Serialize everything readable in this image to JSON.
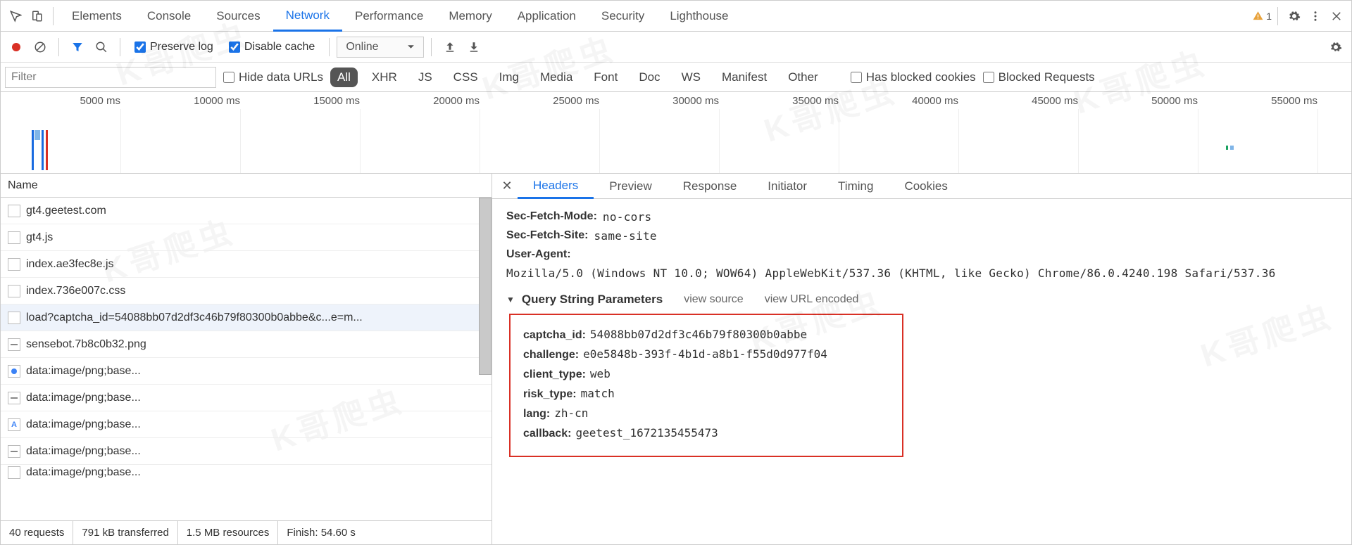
{
  "mainTabs": {
    "elements": "Elements",
    "console": "Console",
    "sources": "Sources",
    "network": "Network",
    "performance": "Performance",
    "memory": "Memory",
    "application": "Application",
    "security": "Security",
    "lighthouse": "Lighthouse"
  },
  "warnCount": "1",
  "netToolbar": {
    "preserve": "Preserve log",
    "disable": "Disable cache",
    "throttle": "Online"
  },
  "filterRow": {
    "placeholder": "Filter",
    "hide": "Hide data URLs",
    "types": {
      "all": "All",
      "xhr": "XHR",
      "js": "JS",
      "css": "CSS",
      "img": "Img",
      "media": "Media",
      "font": "Font",
      "doc": "Doc",
      "ws": "WS",
      "manifest": "Manifest",
      "other": "Other"
    },
    "blockedCookies": "Has blocked cookies",
    "blockedReq": "Blocked Requests"
  },
  "timelineTicks": [
    "5000 ms",
    "10000 ms",
    "15000 ms",
    "20000 ms",
    "25000 ms",
    "30000 ms",
    "35000 ms",
    "40000 ms",
    "45000 ms",
    "50000 ms",
    "55000 ms"
  ],
  "reqListHeader": "Name",
  "requests": [
    {
      "name": "gt4.geetest.com",
      "icon": "doc"
    },
    {
      "name": "gt4.js",
      "icon": "doc"
    },
    {
      "name": "index.ae3fec8e.js",
      "icon": "doc"
    },
    {
      "name": "index.736e007c.css",
      "icon": "doc"
    },
    {
      "name": "load?captcha_id=54088bb07d2df3c46b79f80300b0abbe&c...e=m...",
      "icon": "doc",
      "selected": true
    },
    {
      "name": "sensebot.7b8c0b32.png",
      "icon": "img"
    },
    {
      "name": "data:image/png;base...",
      "icon": "imgblue"
    },
    {
      "name": "data:image/png;base...",
      "icon": "img"
    },
    {
      "name": "data:image/png;base...",
      "icon": "imgA"
    },
    {
      "name": "data:image/png;base...",
      "icon": "img"
    },
    {
      "name": "data:image/png;base...",
      "icon": "doc",
      "cut": true
    }
  ],
  "status": {
    "requests": "40 requests",
    "transferred": "791 kB transferred",
    "resources": "1.5 MB resources",
    "finish": "Finish: 54.60 s"
  },
  "detailTabs": {
    "headers": "Headers",
    "preview": "Preview",
    "response": "Response",
    "initiator": "Initiator",
    "timing": "Timing",
    "cookies": "Cookies"
  },
  "respHeaders": [
    {
      "k": "Sec-Fetch-Mode:",
      "v": "no-cors"
    },
    {
      "k": "Sec-Fetch-Site:",
      "v": "same-site"
    },
    {
      "k": "User-Agent:",
      "v": "Mozilla/5.0 (Windows NT 10.0; WOW64) AppleWebKit/537.36 (KHTML, like Gecko) Chrome/86.0.4240.198 Safari/537.36"
    }
  ],
  "querySection": {
    "title": "Query String Parameters",
    "viewSource": "view source",
    "viewUrl": "view URL encoded"
  },
  "queryParams": [
    {
      "k": "captcha_id:",
      "v": "54088bb07d2df3c46b79f80300b0abbe"
    },
    {
      "k": "challenge:",
      "v": "e0e5848b-393f-4b1d-a8b1-f55d0d977f04"
    },
    {
      "k": "client_type:",
      "v": "web"
    },
    {
      "k": "risk_type:",
      "v": "match"
    },
    {
      "k": "lang:",
      "v": "zh-cn"
    },
    {
      "k": "callback:",
      "v": "geetest_1672135455473"
    }
  ],
  "watermark": "K哥爬虫"
}
